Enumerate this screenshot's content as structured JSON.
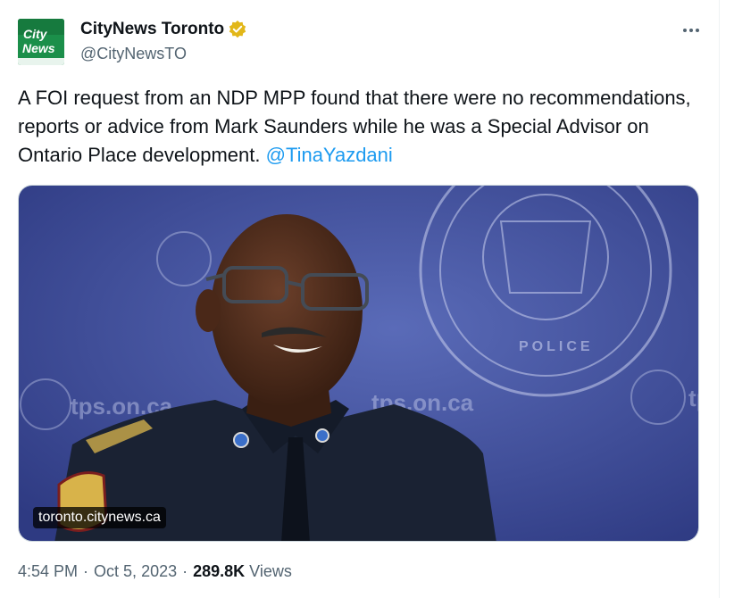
{
  "author": {
    "display_name": "CityNews Toronto",
    "handle": "@CityNewsTO",
    "avatar_text_line1": "City",
    "avatar_text_line2": "News",
    "verified_icon": "verified-badge-gold"
  },
  "more_icon": "more-horizontal-icon",
  "tweet": {
    "text_prefix": "A FOI request from an NDP MPP found that there were no recommendations, reports or advice from Mark Saunders while he was a Special Advisor on Ontario Place development. ",
    "mention": "@TinaYazdani"
  },
  "media": {
    "link_label": "toronto.citynews.ca",
    "backdrop_text": "tps.on.ca",
    "seal_text": "POLICE"
  },
  "meta": {
    "time": "4:54 PM",
    "separator": "·",
    "date": "Oct 5, 2023",
    "views_count": "289.8K",
    "views_label": "Views"
  },
  "colors": {
    "accent": "#1d9bf0",
    "verified": "#e2b719",
    "text": "#0f1419",
    "muted": "#536471",
    "brand_green": "#1b8f4a"
  }
}
